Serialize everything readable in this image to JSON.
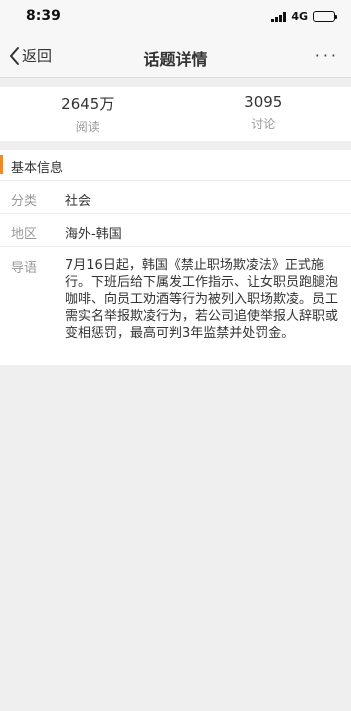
{
  "status_bar": {
    "time": "8:39",
    "network": "4G"
  },
  "nav": {
    "back_label": "返回",
    "title": "话题详情",
    "more_label": "···"
  },
  "stats": [
    {
      "value": "2645万",
      "label": "阅读"
    },
    {
      "value": "3095",
      "label": "讨论"
    }
  ],
  "info": {
    "section_title": "基本信息",
    "rows": [
      {
        "label": "分类",
        "value": "社会"
      },
      {
        "label": "地区",
        "value": "海外-韩国"
      },
      {
        "label": "导语",
        "value": "7月16日起，韩国《禁止职场欺凌法》正式施行。下班后给下属发工作指示、让女职员跑腿泡咖啡、向员工劝酒等行为被列入职场欺凌。员工需实名举报欺凌行为，若公司追使举报人辞职或变相惩罚，最高可判3年监禁并处罚金。"
      }
    ]
  }
}
